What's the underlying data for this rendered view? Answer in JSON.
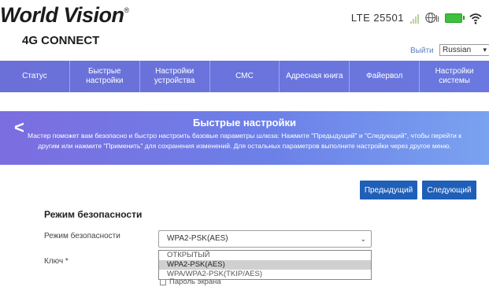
{
  "header": {
    "brand_name": "World Vision",
    "brand_reg": "®",
    "brand_sub": "4G CONNECT",
    "network": "LTE  25501",
    "logout": "Выйти",
    "language": "Russian",
    "icons": [
      "signal-icon",
      "globe-icon",
      "battery-icon",
      "wifi-icon"
    ]
  },
  "nav": {
    "items": [
      {
        "label": "Статус"
      },
      {
        "label": "Быстрые настройки"
      },
      {
        "label": "Настройки устройства"
      },
      {
        "label": "СМС"
      },
      {
        "label": "Адресная книга"
      },
      {
        "label": "Файервол"
      },
      {
        "label": "Настройки системы"
      }
    ]
  },
  "banner": {
    "title": "Быстрые настройки",
    "description": "Мастер поможет вам безопасно и быстро настроить базовые параметры шлюза: Нажмите \"Предыдущий\" и \"Следующий\", чтобы перейти к другим или нажмите \"Применить\" для сохранения изменений. Для остальных параметров выполните настройки через другое меню."
  },
  "buttons": {
    "prev": "Предыдущий",
    "next": "Следующий"
  },
  "form": {
    "section_title": "Режим безопасности",
    "mode_label": "Режим безопасности",
    "mode_value": "WPA2-PSK(AES)",
    "mode_options": [
      "ОТКРЫТЫЙ",
      "WPA2-PSK(AES)",
      "WPA/WPA2-PSK(TKIP/AES)"
    ],
    "mode_selected_index": 1,
    "key_label": "Ключ *",
    "show_password": "Пароль экрана"
  },
  "colors": {
    "nav": "#6a74dc",
    "banner_start": "#7c6de0",
    "banner_end": "#7aa2f0",
    "button": "#1f5fb8"
  }
}
